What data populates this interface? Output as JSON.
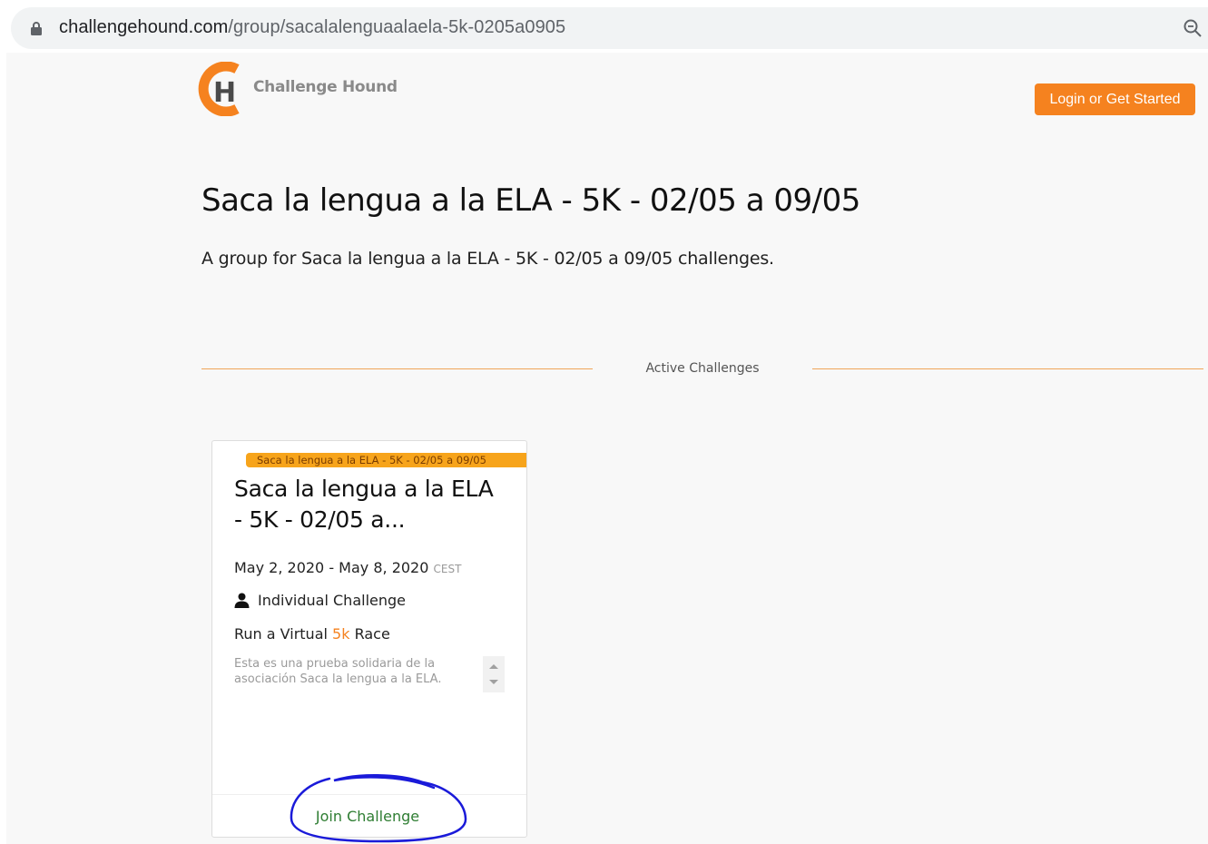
{
  "browser": {
    "url_domain": "challengehound.com",
    "url_path": "/group/sacalalenguaalaela-5k-0205a0905"
  },
  "header": {
    "logo_letter": "H",
    "brand": "Challenge Hound",
    "login_label": "Login or Get Started"
  },
  "group": {
    "title": "Saca la lengua a la ELA - 5K - 02/05 a 09/05",
    "description": "A group for Saca la lengua a la ELA - 5K - 02/05 a 09/05 challenges."
  },
  "section": {
    "label": "Active Challenges"
  },
  "challenge": {
    "tag": "Saca la lengua a la ELA - 5K - 02/05 a 09/05",
    "title": "Saca la lengua a la ELA - 5K - 02/05 a...",
    "dates": "May 2, 2020 - May 8, 2020",
    "timezone": "CEST",
    "type": "Individual Challenge",
    "goal_prefix": "Run a Virtual",
    "goal_distance": "5k",
    "goal_suffix": "Race",
    "description": "Esta es una prueba solidaria de la asociación Saca la lengua a la ELA.",
    "join_label": "Join Challenge"
  },
  "colors": {
    "accent": "#f5821f",
    "tag": "#f7a41b",
    "join": "#2e7d32",
    "annotation": "#1a1ad9"
  },
  "icons": [
    "lock-icon",
    "zoom-out-icon",
    "person-icon",
    "scroll-up-icon",
    "scroll-down-icon"
  ]
}
